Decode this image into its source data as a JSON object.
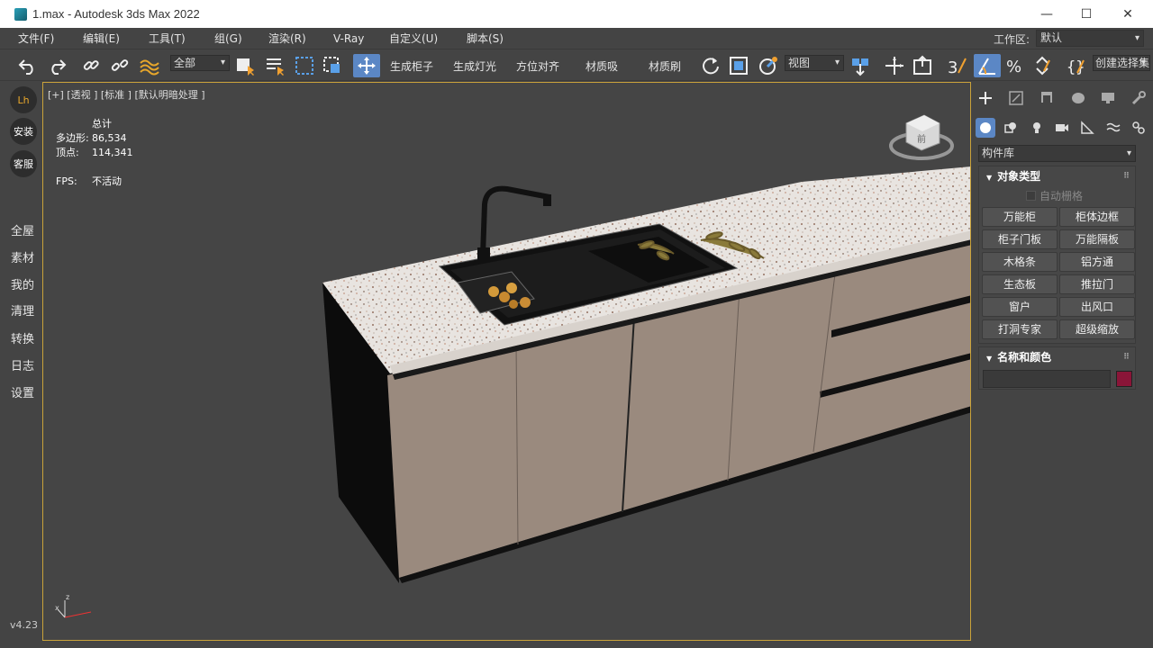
{
  "window": {
    "title": "1.max - Autodesk 3ds Max 2022"
  },
  "menu": {
    "items": [
      "文件(F)",
      "编辑(E)",
      "工具(T)",
      "组(G)",
      "渲染(R)",
      "V-Ray",
      "自定义(U)",
      "脚本(S)"
    ],
    "workspace_label": "工作区:",
    "workspace_value": "默认"
  },
  "toolbar": {
    "selection_filter": "全部",
    "btn_cabinet": "生成柜子",
    "btn_light": "生成灯光",
    "btn_align": "方位对齐",
    "btn_mat_pick": "材质吸",
    "btn_mat_brush": "材质刷",
    "view_drop": "视图",
    "create_selection": "创建选择集"
  },
  "leftdock": {
    "circle_buttons": [
      "Lh",
      "安装",
      "客服"
    ],
    "text_items": [
      "全屋",
      "素材",
      "我的",
      "清理",
      "转换",
      "日志",
      "设置"
    ],
    "version": "v4.23"
  },
  "viewport": {
    "label": "[+] [透视 ] [标准 ] [默认明暗处理 ]",
    "stats_header": "总计",
    "polygons_label": "多边形:",
    "polygons_value": "86,534",
    "vertices_label": "顶点:",
    "vertices_value": "114,341",
    "fps_label": "FPS:",
    "fps_value": "不活动",
    "viewcube_label": "前"
  },
  "rightpanel": {
    "library_drop": "构件库",
    "object_type": {
      "title": "对象类型",
      "autogrid": "自动栅格",
      "buttons": [
        "万能柜",
        "柜体边框",
        "柜子门板",
        "万能隔板",
        "木格条",
        "铝方通",
        "生态板",
        "推拉门",
        "窗户",
        "出风口",
        "打洞专家",
        "超级缩放"
      ]
    },
    "name_color": {
      "title": "名称和颜色",
      "color": "#8a1538"
    }
  }
}
